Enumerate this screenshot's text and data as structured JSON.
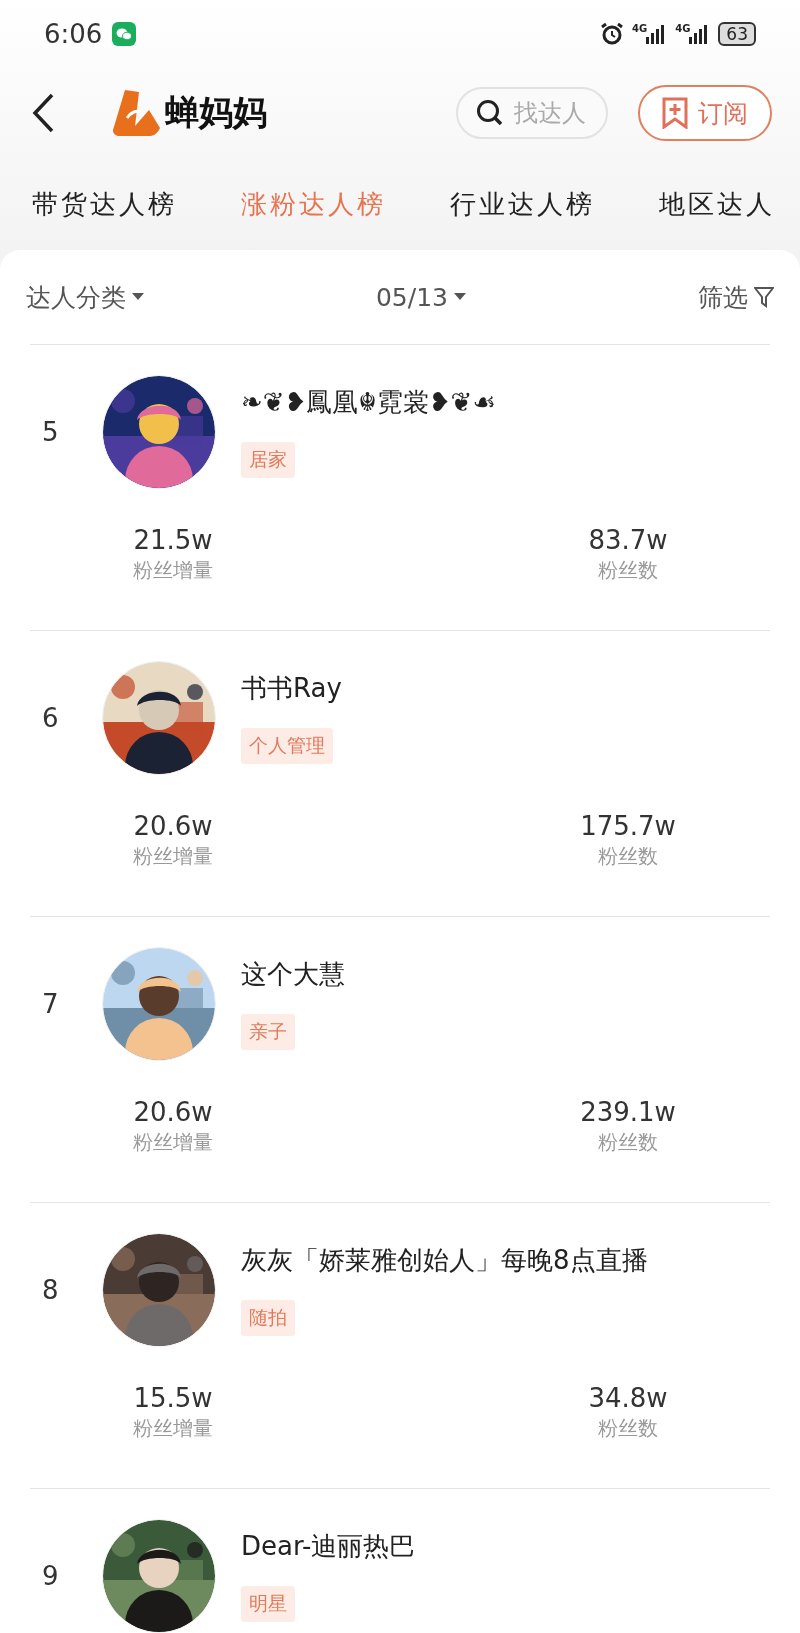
{
  "status_bar": {
    "time": "6:06",
    "network_labels": [
      "4G",
      "4G"
    ],
    "battery": "63"
  },
  "header": {
    "logo": "蝉妈妈",
    "search": {
      "placeholder": "找达人"
    },
    "subscribe": "订阅"
  },
  "tabs": [
    {
      "label": "带货达人榜",
      "selected": false
    },
    {
      "label": "涨粉达人榜",
      "selected": true
    },
    {
      "label": "行业达人榜",
      "selected": false
    },
    {
      "label": "地区达人",
      "selected": false
    }
  ],
  "filters": {
    "category": "达人分类",
    "date": "05/13",
    "filter": "筛选"
  },
  "rows": [
    {
      "rank": "5",
      "name": "❧❦❥鳳凰☬霓裳❥❦☙",
      "tag": "居家",
      "gain": "21.5w",
      "gain_label": "粉丝增量",
      "fans": "83.7w",
      "fans_label": "粉丝数"
    },
    {
      "rank": "6",
      "name": "书书Ray",
      "tag": "个人管理",
      "gain": "20.6w",
      "gain_label": "粉丝增量",
      "fans": "175.7w",
      "fans_label": "粉丝数"
    },
    {
      "rank": "7",
      "name": "这个大慧",
      "tag": "亲子",
      "gain": "20.6w",
      "gain_label": "粉丝增量",
      "fans": "239.1w",
      "fans_label": "粉丝数"
    },
    {
      "rank": "8",
      "name": "灰灰「娇莱雅创始人」每晚8点直播",
      "tag": "随拍",
      "gain": "15.5w",
      "gain_label": "粉丝增量",
      "fans": "34.8w",
      "fans_label": "粉丝数"
    },
    {
      "rank": "9",
      "name": "Dear-迪丽热巴",
      "tag": "明星"
    }
  ]
}
